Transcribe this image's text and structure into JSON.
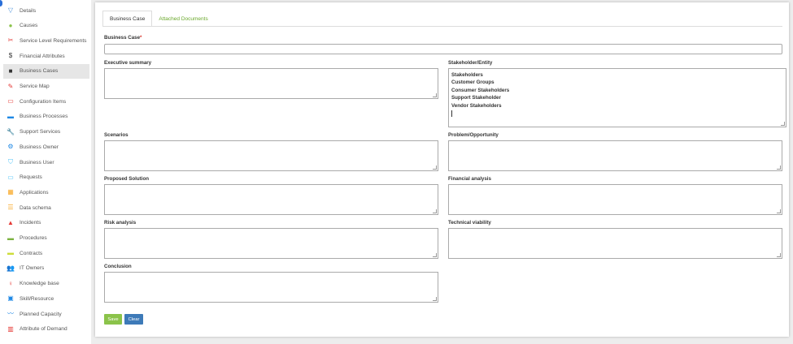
{
  "sidebar": {
    "items": [
      {
        "label": "Details",
        "icon": "filter-icon",
        "glyph": "▽",
        "color": "#4a90d9"
      },
      {
        "label": "Causes",
        "icon": "causes-icon",
        "glyph": "●",
        "color": "#8bc34a"
      },
      {
        "label": "Service Level Requirements",
        "icon": "tools-icon",
        "glyph": "✂",
        "color": "#e53935"
      },
      {
        "label": "Financial Attributes",
        "icon": "dollar-icon",
        "glyph": "$",
        "color": "#333333"
      },
      {
        "label": "Business Cases",
        "icon": "briefcase-icon",
        "glyph": "■",
        "color": "#333333"
      },
      {
        "label": "Service Map",
        "icon": "pencil-icon",
        "glyph": "✎",
        "color": "#e53935"
      },
      {
        "label": "Configuration Items",
        "icon": "monitor-icon",
        "glyph": "▭",
        "color": "#e53935"
      },
      {
        "label": "Business Processes",
        "icon": "suitcase-icon",
        "glyph": "▬",
        "color": "#1e88e5"
      },
      {
        "label": "Support Services",
        "icon": "wrench-icon",
        "glyph": "🔧",
        "color": "#555555"
      },
      {
        "label": "Business Owner",
        "icon": "gear-icon",
        "glyph": "⚙",
        "color": "#1e88e5"
      },
      {
        "label": "Business User",
        "icon": "shield-icon",
        "glyph": "⛉",
        "color": "#4fc3f7"
      },
      {
        "label": "Requests",
        "icon": "ticket-icon",
        "glyph": "▭",
        "color": "#4fc3f7"
      },
      {
        "label": "Applications",
        "icon": "grid-icon",
        "glyph": "▦",
        "color": "#f9a825"
      },
      {
        "label": "Data schema",
        "icon": "list-icon",
        "glyph": "☰",
        "color": "#f9a825"
      },
      {
        "label": "Incidents",
        "icon": "warning-icon",
        "glyph": "▲",
        "color": "#e53935"
      },
      {
        "label": "Procedures",
        "icon": "folder-icon",
        "glyph": "▬",
        "color": "#7cb342"
      },
      {
        "label": "Contracts",
        "icon": "folder-open-icon",
        "glyph": "▬",
        "color": "#cddc39"
      },
      {
        "label": "IT Owners",
        "icon": "users-icon",
        "glyph": "👥",
        "color": "#f9a825"
      },
      {
        "label": "Knowledge base",
        "icon": "lightbulb-icon",
        "glyph": "♀",
        "color": "#e53935"
      },
      {
        "label": "Skill/Resource",
        "icon": "id-card-icon",
        "glyph": "▣",
        "color": "#1e88e5"
      },
      {
        "label": "Planned Capacity",
        "icon": "chart-line-icon",
        "glyph": "〰",
        "color": "#1e88e5"
      },
      {
        "label": "Attribute of Demand",
        "icon": "book-icon",
        "glyph": "▥",
        "color": "#e53935"
      }
    ],
    "active_index": 4
  },
  "tabs": [
    {
      "label": "Business Case",
      "active": true
    },
    {
      "label": "Attached Documents",
      "active": false
    }
  ],
  "form": {
    "business_case_label": "Business Case",
    "required_mark": "*",
    "business_case_value": "",
    "executive_summary_label": "Executive summary",
    "stakeholder_label": "Stakeholder/Entity",
    "stakeholder_lines": [
      "Stakeholders",
      "Customer Groups",
      "Consumer Stakeholders",
      "Support Stakeholder",
      "Vendor Stakeholders"
    ],
    "scenarios_label": "Scenarios",
    "problem_label": "Problem/Opportunity",
    "proposed_solution_label": "Proposed Solution",
    "financial_analysis_label": "Financial analysis",
    "risk_analysis_label": "Risk analysis",
    "technical_viability_label": "Technical viability",
    "conclusion_label": "Conclusion"
  },
  "buttons": {
    "save_label": "Save",
    "clear_label": "Clear",
    "save_color": "#8bc34a",
    "clear_color": "#3d7ab8"
  }
}
